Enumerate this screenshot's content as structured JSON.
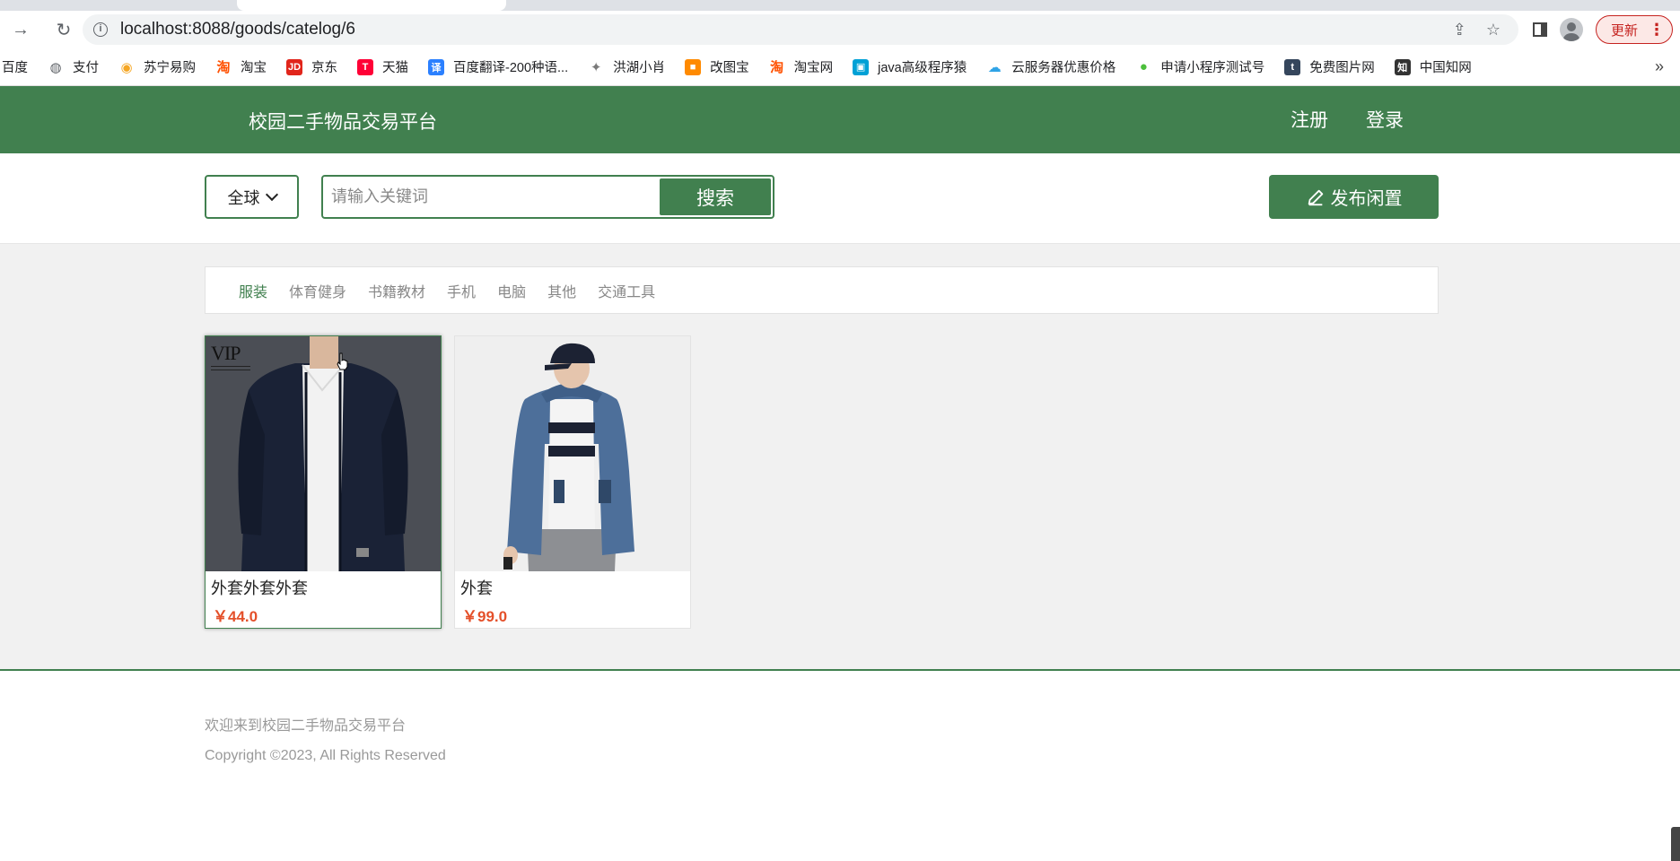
{
  "browser": {
    "url": "localhost:8088/goods/catelog/6",
    "update_label": "更新",
    "bookmarks": [
      {
        "label": "百度",
        "icon": "baidu-icon",
        "color": "#ffffff"
      },
      {
        "label": "支付",
        "icon": "globe-icon",
        "color": "#5f6368"
      },
      {
        "label": "苏宁易购",
        "icon": "suning-icon",
        "color": "#f5a623"
      },
      {
        "label": "淘宝",
        "icon": "taobao-icon",
        "color": "#ff5000"
      },
      {
        "label": "京东",
        "icon": "jd-icon",
        "color": "#e1251b"
      },
      {
        "label": "天猫",
        "icon": "tmall-icon",
        "color": "#ff0036"
      },
      {
        "label": "百度翻译-200种语...",
        "icon": "translate-icon",
        "color": "#2b80ff"
      },
      {
        "label": "洪湖小肖",
        "icon": "bird-icon",
        "color": "#7a7a7a"
      },
      {
        "label": "改图宝",
        "icon": "gaitubao-icon",
        "color": "#ff8a00"
      },
      {
        "label": "淘宝网",
        "icon": "taobao-icon",
        "color": "#ff5000"
      },
      {
        "label": "java高级程序猿",
        "icon": "bilibili-icon",
        "color": "#00a1d6"
      },
      {
        "label": "云服务器优惠价格",
        "icon": "cloud-icon",
        "color": "#2fa3e6"
      },
      {
        "label": "申请小程序测试号",
        "icon": "wechat-icon",
        "color": "#4cbf3c"
      },
      {
        "label": "免费图片网",
        "icon": "tumblr-icon",
        "color": "#35465c"
      },
      {
        "label": "中国知网",
        "icon": "cnki-icon",
        "color": "#333333"
      }
    ]
  },
  "header": {
    "site_title": "校园二手物品交易平台",
    "register_label": "注册",
    "login_label": "登录"
  },
  "search": {
    "region_label": "全球",
    "placeholder": "请输入关键词",
    "value": "",
    "button_label": "搜索",
    "publish_label": "发布闲置"
  },
  "categories": [
    {
      "label": "服装",
      "active": true
    },
    {
      "label": "体育健身",
      "active": false
    },
    {
      "label": "书籍教材",
      "active": false
    },
    {
      "label": "手机",
      "active": false
    },
    {
      "label": "电脑",
      "active": false
    },
    {
      "label": "其他",
      "active": false
    },
    {
      "label": "交通工具",
      "active": false
    }
  ],
  "goods": [
    {
      "name": "外套外套外套",
      "price": "￥44.0",
      "image": "dark-navy-jacket-photo",
      "watermark": "VIP"
    },
    {
      "name": "外套",
      "price": "￥99.0",
      "image": "blue-hooded-jacket-photo"
    }
  ],
  "footer": {
    "welcome": "欢迎来到校园二手物品交易平台",
    "copyright": "Copyright ©2023, All Rights Reserved"
  },
  "colors": {
    "brand": "#41804f",
    "price": "#e4502a"
  }
}
